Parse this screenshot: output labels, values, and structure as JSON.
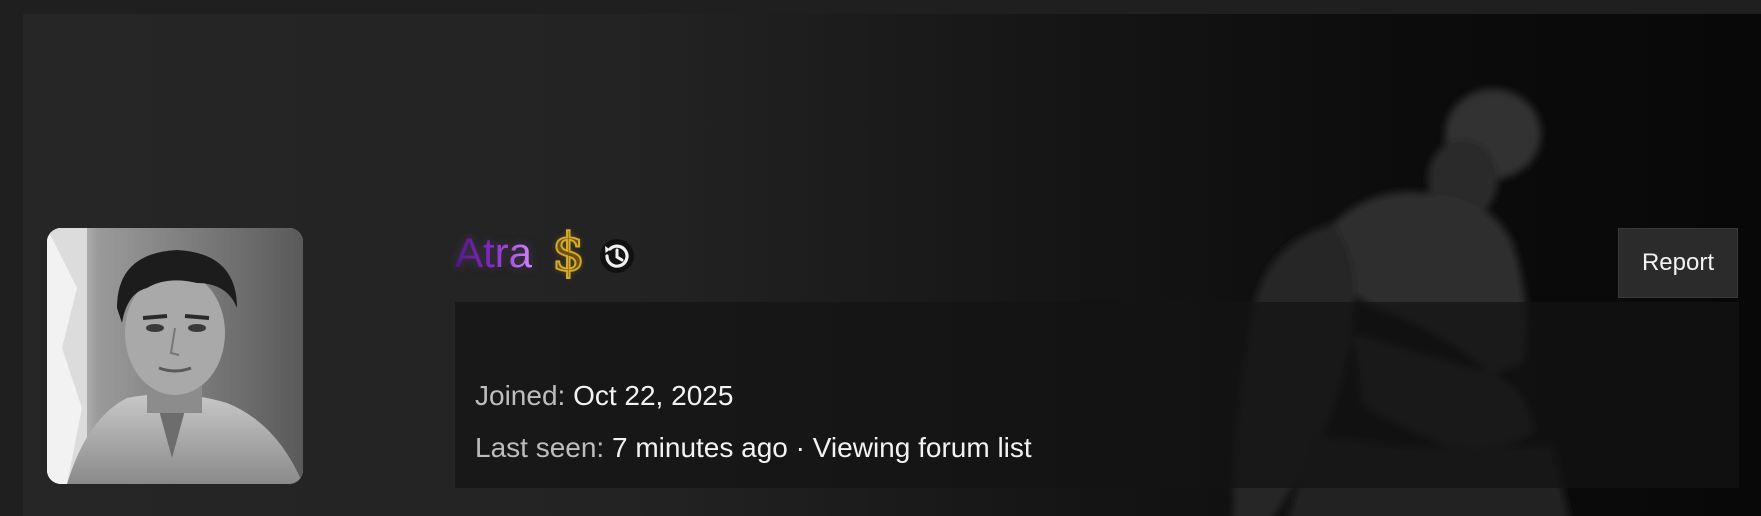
{
  "profile": {
    "username": "Atra",
    "badges": {
      "dollar_symbol": "$",
      "dollar_icon": "dollar-sign-icon",
      "history_icon": "history-icon"
    },
    "report_label": "Report",
    "joined_label": "Joined:",
    "joined_value": "Oct 22, 2025",
    "last_seen_label": "Last seen:",
    "last_seen_value": "7 minutes ago",
    "separator": "·",
    "activity": "Viewing forum list"
  },
  "colors": {
    "page_bg": "#1f1f1f",
    "username_gradient_start": "#4a0f7d",
    "username_gradient_end": "#d388ff",
    "dollar_gold": "#d4a92c",
    "report_bg": "#2b2b2b",
    "label_text": "#bdbdbd",
    "value_text": "#f2f2f2"
  }
}
